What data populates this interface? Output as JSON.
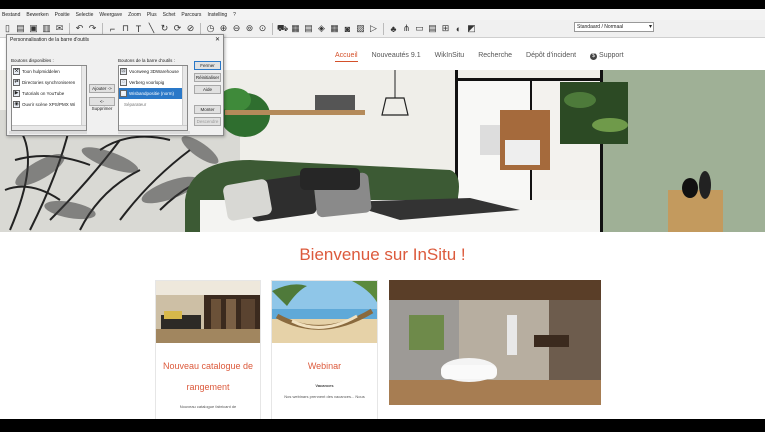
{
  "menubar": [
    "Bestand",
    "Bewerken",
    "Positie",
    "Selectie",
    "Weergave",
    "Zoom",
    "Plus",
    "Schet",
    "Parcours",
    "Instelling",
    "?"
  ],
  "toolbar": {
    "view_select": "Standaard / Normaal"
  },
  "dialog": {
    "title": "Personnalisation de la barre d'outils",
    "close": "✕",
    "available_label": "Boutons disponibles :",
    "toolbar_label": "Boutons de la barre d'outils :",
    "available_items": [
      {
        "label": "Toon hulpmiddelen",
        "icon": "wrench-icon"
      },
      {
        "label": "Directories synchroniseren",
        "icon": "sync-icon"
      },
      {
        "label": "Tutorials on YouTube",
        "icon": "youtube-icon"
      },
      {
        "label": "Ouvrir scène XPS/PMX Wi",
        "icon": "globe-icon"
      }
    ],
    "toolbar_items": [
      {
        "label": "Voorweeg 3DWarehouse",
        "icon": "warehouse-icon"
      },
      {
        "label": "Verberg voorlopig",
        "icon": "hide-icon"
      },
      {
        "label": "Wisbandpositie (norm)",
        "icon": "list-icon",
        "selected": true
      },
      {
        "label": "Séparateur",
        "icon": ""
      }
    ],
    "add_btn": "Ajouter ->",
    "remove_btn": "<- Supprimer",
    "close_btn": "Fermer",
    "reset_btn": "Réinitialiser",
    "help_btn": "Aide",
    "up_btn": "Monter",
    "down_btn": "Descendre"
  },
  "nav": {
    "items": [
      "Accueil",
      "Nouveautés 9.1",
      "WikInSitu",
      "Recherche",
      "Dépôt d'incident"
    ],
    "support": "Support",
    "active": "Accueil"
  },
  "welcome": "Bienvenue sur InSitu !",
  "cards": [
    {
      "title": "Nouveau catalogue de rangement",
      "text": "Nouveau     catalogue     fabricant     de"
    },
    {
      "title": "Webinar",
      "subtitle": "Vacances",
      "text": "Nos webinars prennent des vacances... Nous"
    }
  ],
  "colors": {
    "accent": "#dc5a3c",
    "selection": "#2a78c8"
  }
}
